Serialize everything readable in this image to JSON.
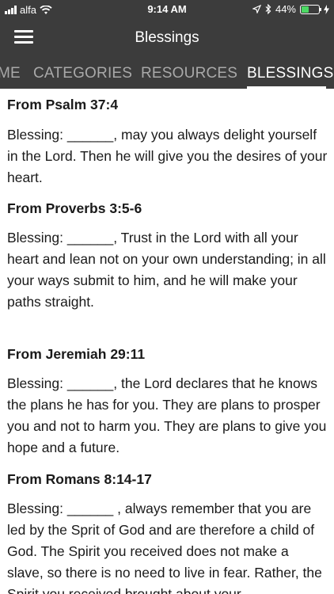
{
  "status_bar": {
    "carrier": "alfa",
    "time": "9:14 AM",
    "battery": "44%",
    "battery_level": 0.44
  },
  "header": {
    "title": "Blessings"
  },
  "tabs": [
    {
      "label": "ME"
    },
    {
      "label": "CATEGORIES"
    },
    {
      "label": "RESOURCES"
    },
    {
      "label": "BLESSINGS",
      "active": true
    }
  ],
  "entries": [
    {
      "heading": "From Psalm 37:4",
      "body": "Blessing: ______, may you always delight yourself in the Lord. Then he will give you the desires of your heart."
    },
    {
      "heading": "From Proverbs 3:5-6",
      "body": "Blessing: ______, Trust in the Lord with all your heart and lean not on your own understanding; in all your ways submit to him, and he will make your paths straight."
    },
    {
      "heading": "From Jeremiah 29:11",
      "body": "Blessing: ______, the Lord declares that he knows the plans he has for you. They are plans to prosper you and not to harm you. They are plans to give you hope and a future."
    },
    {
      "heading": "From Romans 8:14-17",
      "body": "Blessing: ______ , always remember that you are led by the Sprit of God and are therefore a child of God. The Spirit you received does not make a slave, so there is no need to live in fear. Rather, the Spirit you received brought about your"
    }
  ]
}
